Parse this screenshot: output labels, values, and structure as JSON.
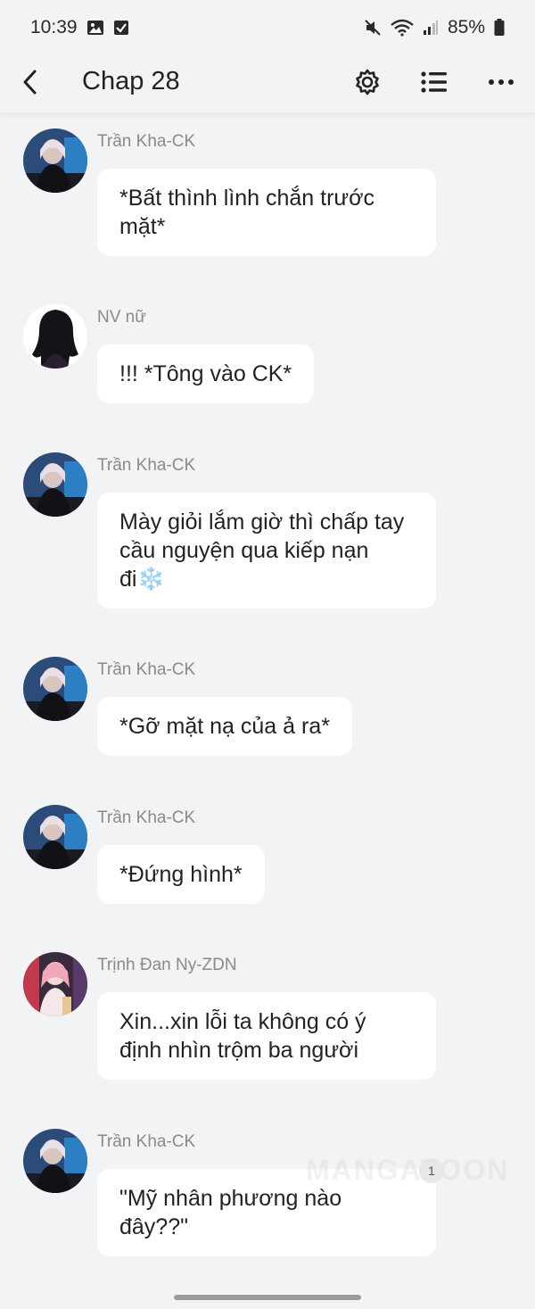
{
  "status_bar": {
    "time": "10:39",
    "battery": "85%",
    "icons": [
      "gallery-icon",
      "checkbox-icon",
      "mute-icon",
      "wifi-icon",
      "signal-icon",
      "battery-icon"
    ]
  },
  "app_bar": {
    "title": "Chap 28",
    "icons": [
      "back-arrow-icon",
      "gear-icon",
      "list-icon",
      "more-icon"
    ]
  },
  "messages": [
    {
      "sender": "Trần Kha-CK",
      "text": "*Bất thình lình chắn trước mặt*",
      "avatar": "tran-kha"
    },
    {
      "sender": "NV nữ",
      "text": "!!! *Tông vào CK*",
      "avatar": "silhouette"
    },
    {
      "sender": "Trần Kha-CK",
      "text": "Mày giỏi lắm giờ thì chấp tay cầu nguyện qua kiếp nạn đi❄️",
      "avatar": "tran-kha"
    },
    {
      "sender": "Trần Kha-CK",
      "text": "*Gỡ mặt nạ của ả ra*",
      "avatar": "tran-kha"
    },
    {
      "sender": "Trần Kha-CK",
      "text": "*Đứng hình*",
      "avatar": "tran-kha"
    },
    {
      "sender": "Trịnh Đan Ny-ZDN",
      "text": "Xin...xin lỗi ta không có ý định nhìn trộm ba người",
      "avatar": "trinh-dan-ny"
    },
    {
      "sender": "Trần Kha-CK",
      "text": "\"Mỹ nhân phương nào đây??\"",
      "avatar": "tran-kha"
    }
  ],
  "overlay": {
    "watermark": "MANGATOON",
    "page_badge": "1"
  },
  "colors": {
    "background": "#f2f3f5",
    "bubble": "#ffffff",
    "sender_text": "#8a8a8e"
  }
}
